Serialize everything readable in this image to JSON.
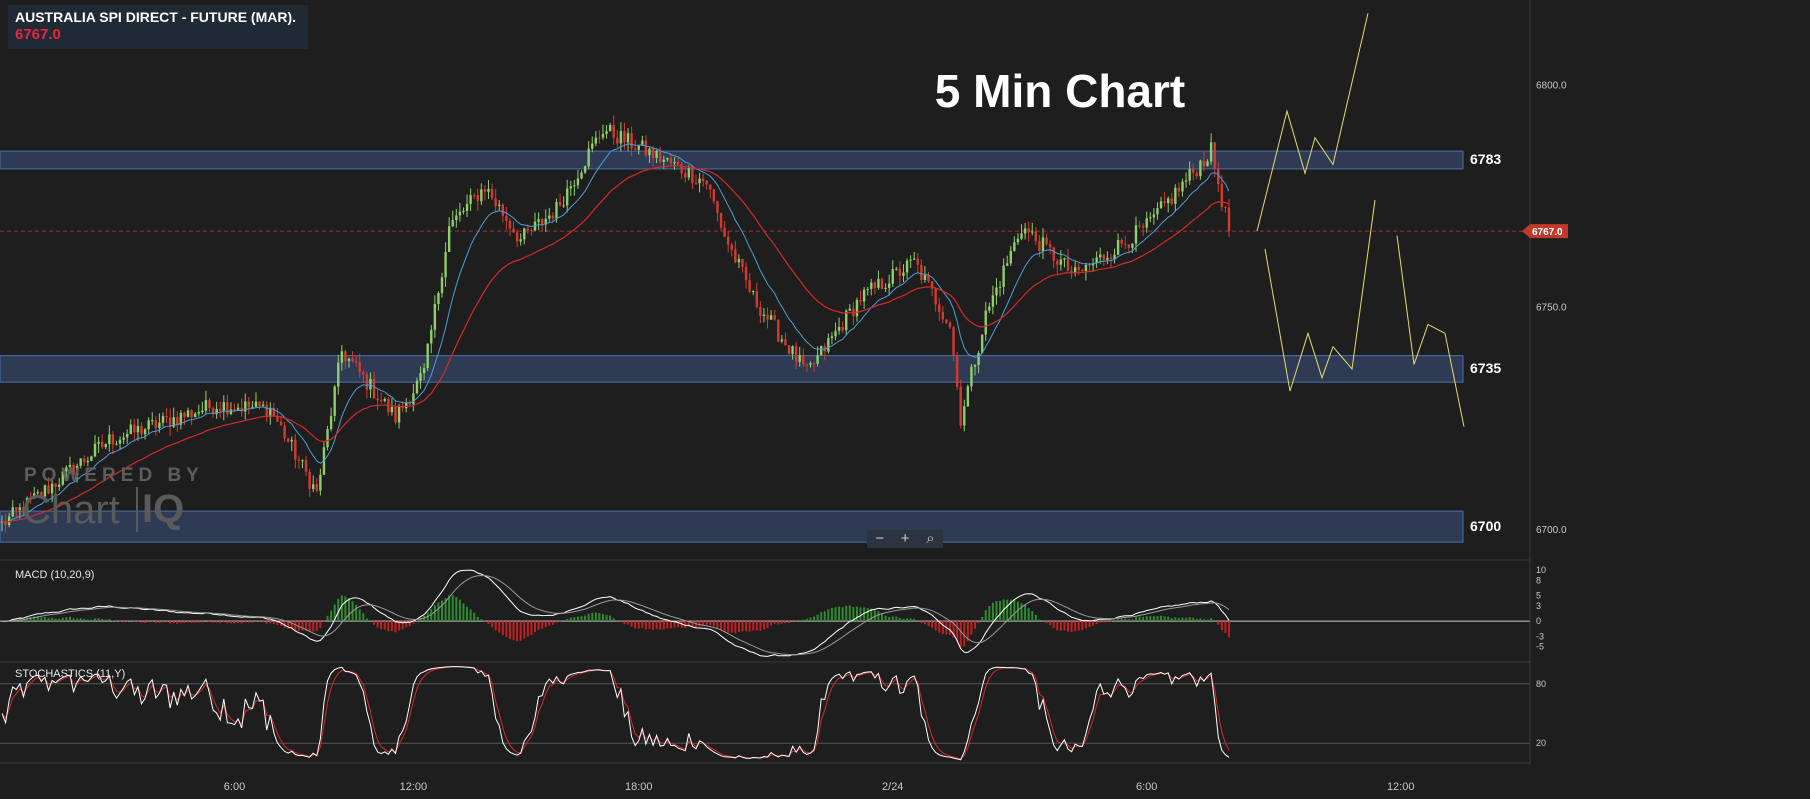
{
  "header": {
    "instrument": "AUSTRALIA SPI DIRECT - FUTURE (MAR).",
    "last_price": "6767.0"
  },
  "annotation": {
    "headline": "5 Min Chart"
  },
  "watermark": {
    "line1": "POWERED BY",
    "brand_a": "Chart",
    "brand_b": "IQ"
  },
  "zoom_controls": {
    "zoom_out": "−",
    "zoom_in": "+",
    "reset_icon": "magnifier-icon"
  },
  "colors": {
    "up": "#8fce6a",
    "down": "#d43b2f",
    "ema_fast": "#4a9ed6",
    "ema_slow": "#d42a2a",
    "projection": "#e8da6a",
    "zone_fill": "#33415e",
    "zone_border": "#4a6ea8",
    "price_tag": "#c0392b"
  },
  "chart_data": [
    {
      "type": "candlestick",
      "panel": "price",
      "price_axis_ticks": [
        "6800.0",
        "6750.0",
        "6700.0"
      ],
      "price_tag": "6767.0",
      "time_ticks": [
        {
          "label": "6:00",
          "candle_index": 65
        },
        {
          "label": "12:00",
          "candle_index": 115
        },
        {
          "label": "18:00",
          "candle_index": 178
        },
        {
          "label": "2/24",
          "candle_index": 249
        },
        {
          "label": "6:00",
          "candle_index": 320
        },
        {
          "label": "12:00",
          "candle_index": 391
        }
      ],
      "ylim": [
        6693,
        6819
      ],
      "candle_count": 344,
      "path_anchors": [
        [
          0,
          6701
        ],
        [
          30,
          6720
        ],
        [
          60,
          6728
        ],
        [
          75,
          6727
        ],
        [
          88,
          6708
        ],
        [
          95,
          6740
        ],
        [
          110,
          6725
        ],
        [
          118,
          6735
        ],
        [
          125,
          6768
        ],
        [
          135,
          6777
        ],
        [
          145,
          6765
        ],
        [
          155,
          6772
        ],
        [
          168,
          6790
        ],
        [
          185,
          6783
        ],
        [
          197,
          6778
        ],
        [
          202,
          6766
        ],
        [
          210,
          6752
        ],
        [
          225,
          6735
        ],
        [
          240,
          6752
        ],
        [
          255,
          6760
        ],
        [
          265,
          6746
        ],
        [
          268,
          6725
        ],
        [
          275,
          6748
        ],
        [
          285,
          6768
        ],
        [
          300,
          6757
        ],
        [
          320,
          6768
        ],
        [
          338,
          6785
        ],
        [
          343,
          6767
        ]
      ],
      "support_resistance_zones": [
        {
          "label": "6783",
          "low": 6781,
          "high": 6785
        },
        {
          "label": "6735",
          "low": 6733,
          "high": 6739
        },
        {
          "label": "6700",
          "low": 6697,
          "high": 6704
        }
      ],
      "moving_averages": [
        {
          "name": "fast"
        },
        {
          "name": "slow"
        }
      ],
      "projection_paths": [
        [
          [
            1257,
            6767
          ],
          [
            1287,
            6794
          ],
          [
            1305,
            6780
          ],
          [
            1315,
            6788
          ],
          [
            1333,
            6782
          ],
          [
            1368,
            6816
          ]
        ],
        [
          [
            1265,
            6763
          ],
          [
            1290,
            6731
          ],
          [
            1308,
            6744
          ],
          [
            1322,
            6734
          ],
          [
            1333,
            6741
          ],
          [
            1352,
            6736
          ],
          [
            1375,
            6774
          ]
        ],
        [
          [
            1397,
            6766
          ],
          [
            1414,
            6737
          ],
          [
            1428,
            6746
          ],
          [
            1445,
            6744
          ],
          [
            1464,
            6723
          ]
        ]
      ]
    },
    {
      "type": "line",
      "panel": "macd",
      "title": "MACD (10,20,9)",
      "axis_ticks": [
        "10",
        "8",
        "5",
        "3",
        "0",
        "-3",
        "-5"
      ],
      "ylim": [
        -8,
        11
      ]
    },
    {
      "type": "line",
      "panel": "stochastics",
      "title": "STOCHASTICS (11,Y)",
      "axis_ticks": [
        "80",
        "20"
      ],
      "ylim": [
        0,
        100
      ]
    }
  ]
}
